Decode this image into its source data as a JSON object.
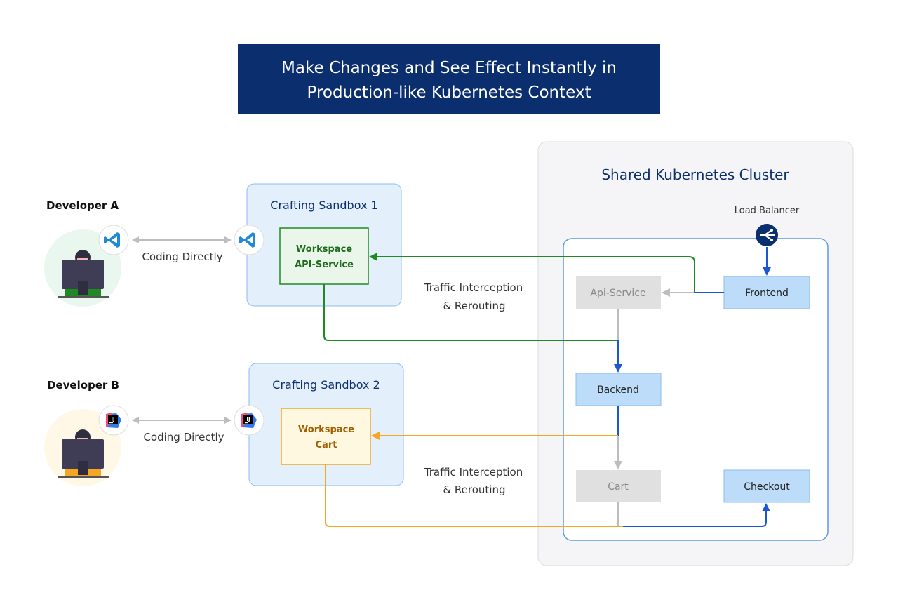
{
  "title": {
    "line1": "Make Changes and See Effect Instantly in",
    "line2": "Production-like Kubernetes Context"
  },
  "colors": {
    "navy": "#0b2e6f",
    "green": "#1f8a24",
    "orange": "#f5a623",
    "blue": "#1a56d6",
    "gray": "#bdbdbd"
  },
  "developers": [
    {
      "label": "Developer A",
      "ide_icon": "vscode-icon",
      "link_label": "Coding Directly"
    },
    {
      "label": "Developer B",
      "ide_icon": "intellij-icon",
      "link_label": "Coding Directly",
      "ide_badge": "IJ"
    }
  ],
  "sandboxes": [
    {
      "title": "Crafting Sandbox 1",
      "workspace_line1": "Workspace",
      "workspace_line2": "API-Service"
    },
    {
      "title": "Crafting Sandbox 2",
      "workspace_line1": "Workspace",
      "workspace_line2": "Cart"
    }
  ],
  "traffic_labels": [
    {
      "line1": "Traffic Interception",
      "line2": "& Rerouting"
    },
    {
      "line1": "Traffic Interception",
      "line2": "& Rerouting"
    }
  ],
  "cluster": {
    "title": "Shared Kubernetes Cluster",
    "load_balancer": "Load Balancer",
    "services": {
      "api": "Api-Service",
      "frontend": "Frontend",
      "backend": "Backend",
      "cart": "Cart",
      "checkout": "Checkout"
    }
  }
}
